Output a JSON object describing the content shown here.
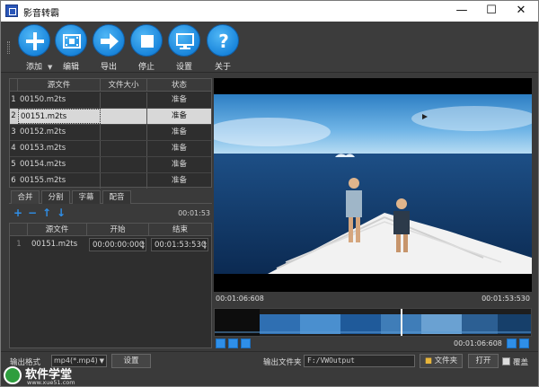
{
  "window": {
    "title": "影音转霸",
    "minimize": "—",
    "maximize": "☐",
    "close": "✕"
  },
  "toolbar": {
    "add": "添加",
    "edit": "编辑",
    "export": "导出",
    "stop": "停止",
    "settings": "设置",
    "about": "关于"
  },
  "file_table": {
    "columns": [
      "源文件",
      "文件大小",
      "状态"
    ],
    "rows": [
      {
        "index": "1",
        "name": "00150.m2ts",
        "size": "",
        "status": "准备"
      },
      {
        "index": "2",
        "name": "00151.m2ts",
        "size": "",
        "status": "准备"
      },
      {
        "index": "3",
        "name": "00152.m2ts",
        "size": "",
        "status": "准备"
      },
      {
        "index": "4",
        "name": "00153.m2ts",
        "size": "",
        "status": "准备"
      },
      {
        "index": "5",
        "name": "00154.m2ts",
        "size": "",
        "status": "准备"
      },
      {
        "index": "6",
        "name": "00155.m2ts",
        "size": "",
        "status": "准备"
      }
    ]
  },
  "tabs": [
    "合并",
    "分割",
    "字幕",
    "配音"
  ],
  "segment": {
    "duration": "00:01:53",
    "columns": [
      "源文件",
      "开始",
      "结束"
    ],
    "row": {
      "index": "1",
      "name": "00151.m2ts",
      "start": "00:00:00:000",
      "end": "00:01:53:530"
    }
  },
  "player": {
    "start_time": "00:01:06:608",
    "end_time": "00:01:53:530",
    "current_time": "00:01:06:608"
  },
  "bottom": {
    "format_label": "输出格式",
    "format_value": "mp4(*.mp4)",
    "settings_button": "设置",
    "output_label": "输出文件夹",
    "output_path": "F:/VWOutput",
    "folder_button": "文件夹",
    "open_button": "打开",
    "overwrite_label": "覆盖"
  },
  "brand": {
    "name": "软件学堂",
    "url": "www.xue51.com"
  },
  "colors": {
    "accent": "#1a86dc",
    "selected_row": "#d8d8d8",
    "background": "#3a3a3a"
  }
}
